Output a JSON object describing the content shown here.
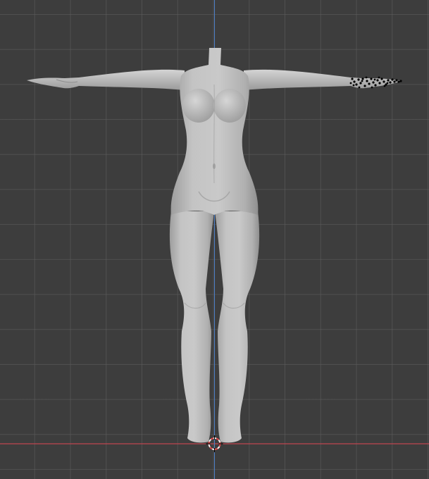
{
  "viewport": {
    "view": "front-orthographic",
    "background_color": "#3d3d3d",
    "grid_line_color": "#5a5a5a",
    "x_axis_color": "#c0454f",
    "z_axis_color": "#4d7fc6",
    "mesh_color": "#bdbdbd",
    "selected_vertex_color": "#000000",
    "cursor_ring_color_a": "#e24a4a",
    "cursor_ring_color_b": "#f2f2f2",
    "icons": [
      "3d-cursor-icon"
    ]
  },
  "scene": {
    "object": "humanoid-female-base-mesh",
    "pose": "t-pose",
    "mode": "edit-mode",
    "selection": "right-hand-vertices"
  }
}
